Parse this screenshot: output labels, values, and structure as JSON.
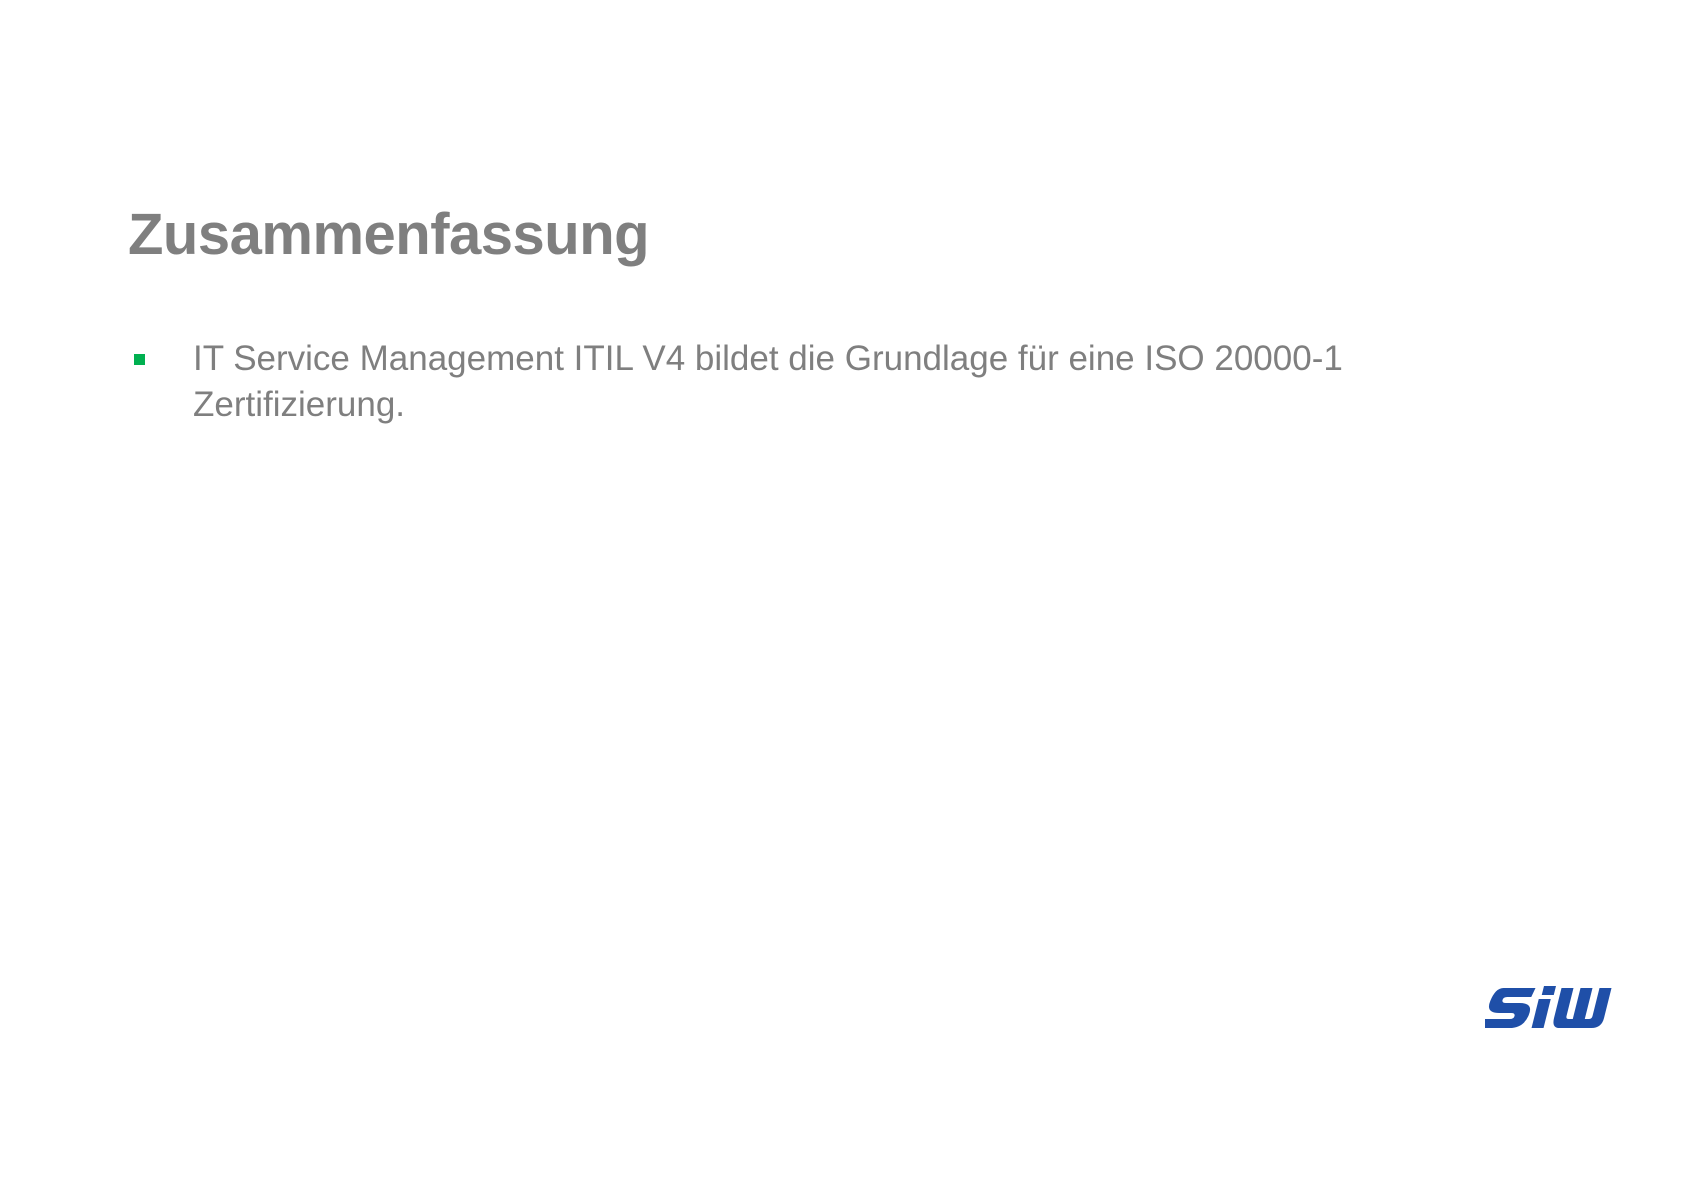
{
  "slide": {
    "title": "Zusammenfassung",
    "bullets": [
      {
        "text": "IT Service Management ITIL V4 bildet die Grundlage für eine ISO 20000-1 Zertifizierung."
      }
    ]
  },
  "logo": {
    "text": "SIW",
    "icon": "siw-logo-icon",
    "color": "#1f4fa8"
  },
  "colors": {
    "text": "#7f7f7f",
    "bullet": "#00b050",
    "background": "#ffffff"
  }
}
